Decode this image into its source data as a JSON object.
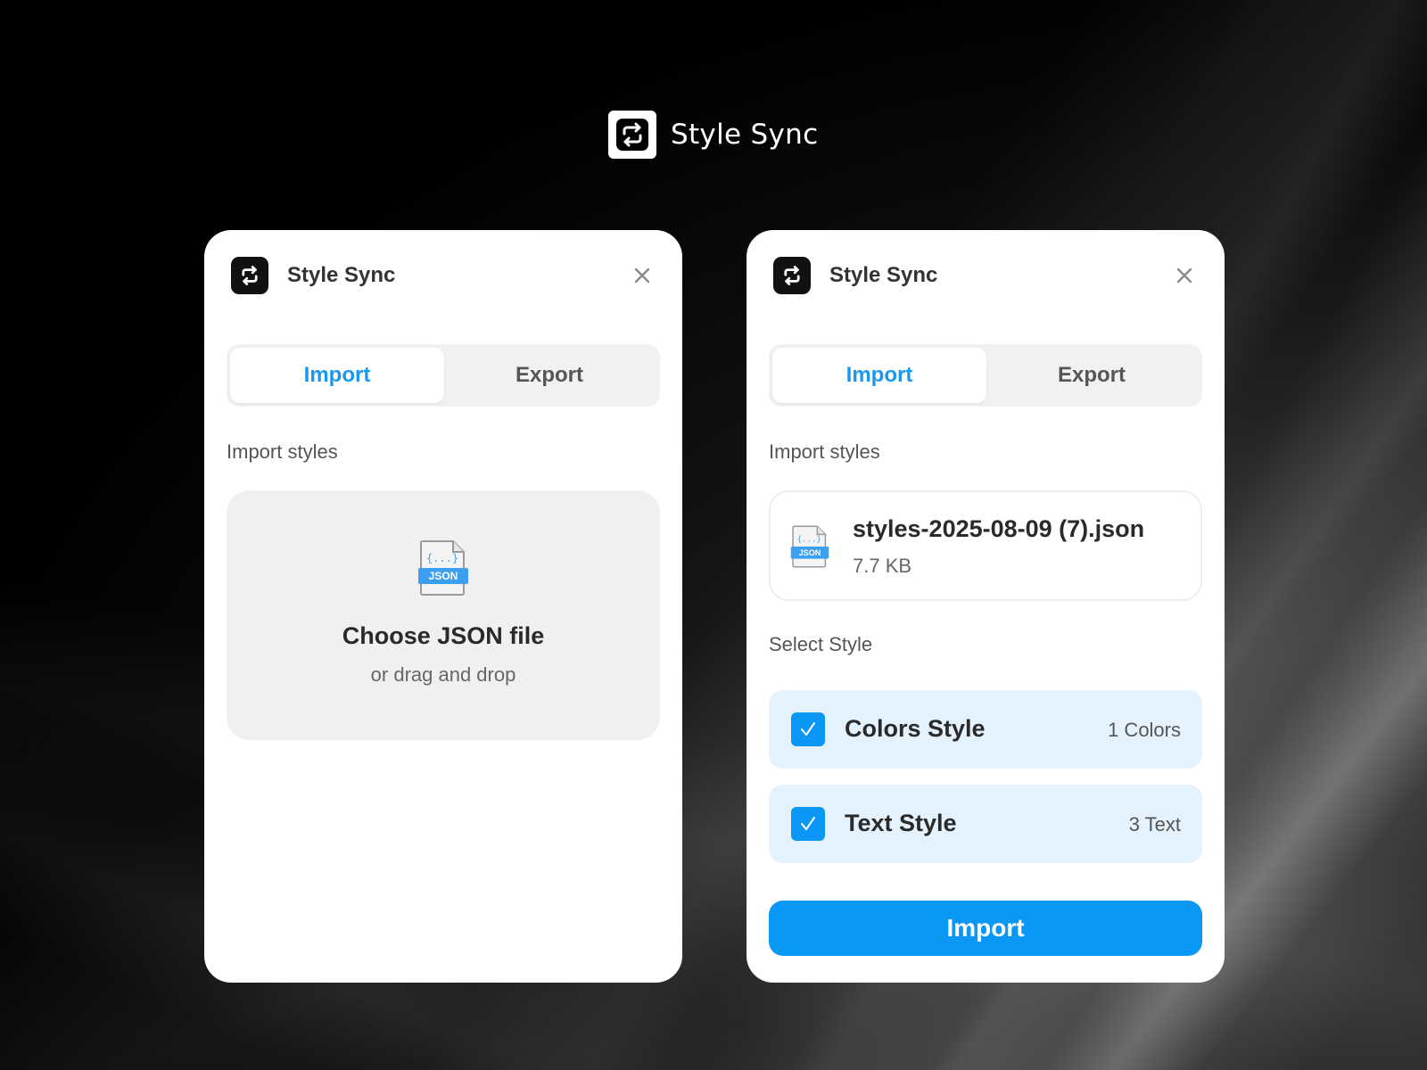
{
  "brand": {
    "name": "Style Sync"
  },
  "left_panel": {
    "title": "Style Sync",
    "tabs": [
      {
        "label": "Import",
        "active": true
      },
      {
        "label": "Export",
        "active": false
      }
    ],
    "section_label": "Import styles",
    "dropzone": {
      "icon_badge": "JSON",
      "icon_braces": "{...}",
      "title": "Choose JSON file",
      "subtitle": "or drag and drop"
    }
  },
  "right_panel": {
    "title": "Style Sync",
    "tabs": [
      {
        "label": "Import",
        "active": true
      },
      {
        "label": "Export",
        "active": false
      }
    ],
    "section_label": "Import styles",
    "file": {
      "name": "styles-2025-08-09 (7).json",
      "size": "7.7 KB",
      "icon_badge": "JSON",
      "icon_braces": "{...}"
    },
    "select_label": "Select Style",
    "styles": [
      {
        "label": "Colors Style",
        "count": "1 Colors",
        "checked": true
      },
      {
        "label": "Text Style",
        "count": "3 Text",
        "checked": true
      }
    ],
    "import_button": "Import"
  },
  "colors": {
    "accent": "#0b97f5",
    "tab_active_text": "#1a98ec",
    "row_bg": "#e3f2fd"
  }
}
